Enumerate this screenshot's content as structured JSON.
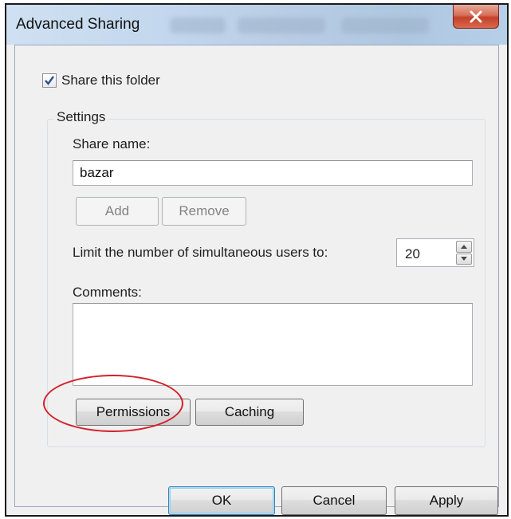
{
  "window": {
    "title": "Advanced Sharing",
    "close_glyph": "X"
  },
  "share": {
    "checkbox_label": "Share this folder",
    "checked": true
  },
  "settings": {
    "legend": "Settings",
    "share_name_label": "Share name:",
    "share_name_value": "bazar",
    "add_label": "Add",
    "remove_label": "Remove",
    "limit_label": "Limit the number of simultaneous users to:",
    "limit_value": "20",
    "comments_label": "Comments:",
    "comments_value": "",
    "permissions_label": "Permissions",
    "caching_label": "Caching"
  },
  "footer": {
    "ok_label": "OK",
    "cancel_label": "Cancel",
    "apply_label": "Apply"
  },
  "colors": {
    "highlight": "#d4202a",
    "check_mark": "#2f4e8a",
    "close_button": "#c4402a"
  }
}
